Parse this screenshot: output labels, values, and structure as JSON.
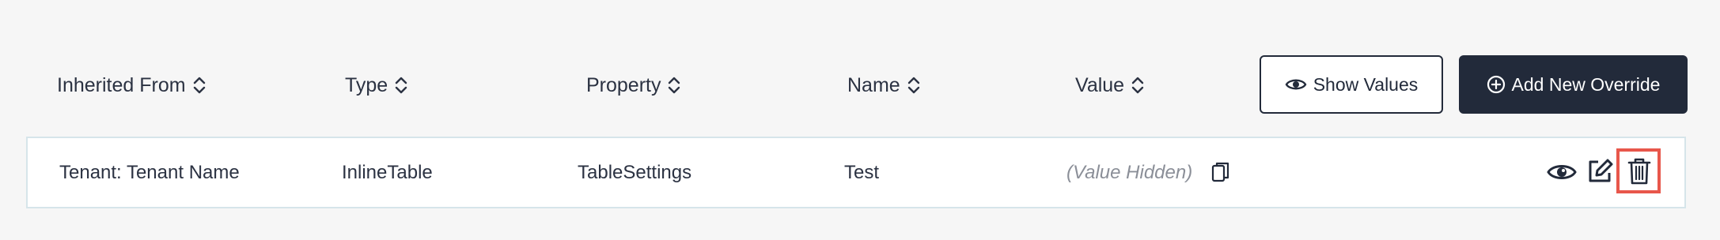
{
  "headers": {
    "inherited_from": "Inherited From",
    "type": "Type",
    "property": "Property",
    "name": "Name",
    "value": "Value"
  },
  "toolbar": {
    "show_values_label": "Show Values",
    "add_override_label": "Add New Override"
  },
  "rows": [
    {
      "inherited_from": "Tenant: Tenant Name",
      "type": "InlineTable",
      "property": "TableSettings",
      "name": "Test",
      "value": "(Value Hidden)"
    }
  ],
  "icons": {
    "sort": "sort-icon",
    "show_values": "eye-icon",
    "add_override": "plus-circle-icon",
    "copy": "copy-icon",
    "view": "eye-icon",
    "edit": "edit-icon",
    "delete": "trash-icon"
  },
  "colors": {
    "background": "#f6f6f6",
    "primary": "#222a3a",
    "row_border": "#d6e5ea",
    "highlight": "#e8574b",
    "muted_text": "#8b8f98"
  }
}
